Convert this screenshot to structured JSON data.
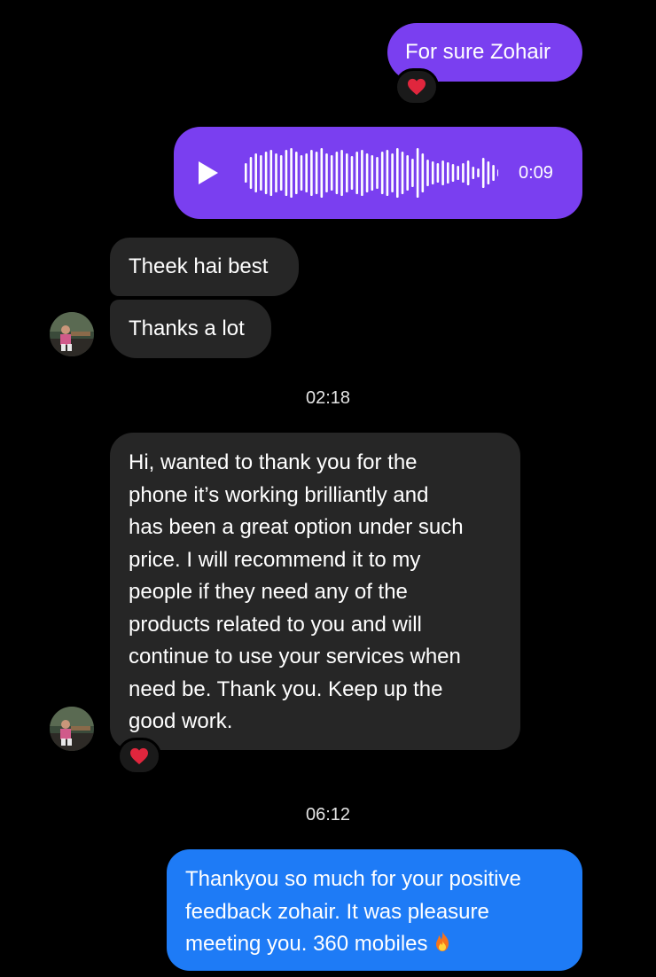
{
  "colors": {
    "background": "#000000",
    "sent_purple": "#7a3ff0",
    "received_gray": "#262626",
    "sent_blue": "#1e7bf6",
    "reaction_heart": "#e0263d"
  },
  "messages": {
    "msg1": {
      "text": "For sure Zohair",
      "reaction": "❤️"
    },
    "voice": {
      "duration": "0:09",
      "icon": "play-icon"
    },
    "msg2": {
      "text": "Theek hai best"
    },
    "msg3": {
      "text": "Thanks a lot"
    },
    "timestamp1": "02:18",
    "msg4": {
      "lines": [
        "Hi, wanted to thank you for the",
        "phone it’s working brilliantly and",
        "has been a great option under such",
        "price. I will recommend it to my",
        "people if they need any of the",
        "products related to you and will",
        "continue to use your services when",
        "need be. Thank you. Keep up the",
        "good work."
      ],
      "reaction": "❤️"
    },
    "timestamp2": "06:12",
    "msg5": {
      "lines": [
        "Thankyou so much for your positive",
        "feedback zohair. It was pleasure",
        "meeting you. 360 mobiles"
      ],
      "emoji": "🔥"
    }
  }
}
